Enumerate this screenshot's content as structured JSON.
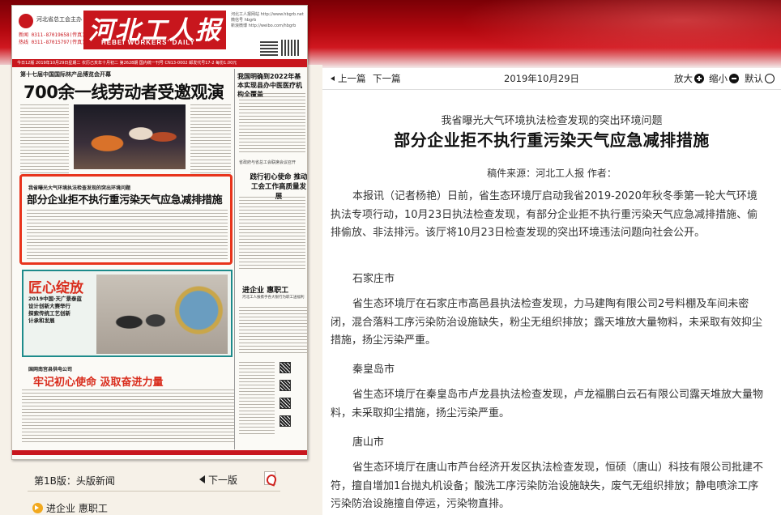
{
  "brand": {
    "accent": "#c8161d",
    "highlight": "#e8341c",
    "teal": "#1d8b8b"
  },
  "newspaper": {
    "sponsor": "河北省总工会主办",
    "tel": "新闻 0311-87019658(传真)\n热线 0311-87015797(传真)",
    "title": "河北工人报",
    "english_title": "HEBEI WORKERS' DAILY",
    "masthead_info": "河北工人报网站 http://www.hbgrb.net\n微信号 hbgrb\n新浪微博 http://weibo.com/hbgrb",
    "date_bar": "今日12版 2019年10月29日星期二 农历己亥年十月初二 第2628期 国内统一刊号 CN13-0002 邮发代号17-2 每份1.00元",
    "kicker1": "第十七届中国国际林产品博览会开幕",
    "head1": "700余一线劳动者受邀观演",
    "side_head1": "我国明确到2022年基本实现县办中医医疗机构全覆盖",
    "side_small": "省政府与省总工会联席会议召开",
    "side_head2": "践行初心使命 推动工会工作高质量发展",
    "highlight_kicker": "我省曝光大气环境执法检查发现的突出环境问题",
    "highlight_title": "部分企业拒不执行重污染天气应急减排措施",
    "ad_title": "匠心绽放",
    "ad_lines": [
      "2019中国·天广景泰蓝",
      "设计创新大赛举行",
      "探索传统工艺创新",
      "计承和发展"
    ],
    "right_box_title": "进企业 惠职工",
    "right_box_sub": "河北工人报携手各大银行为职工送福利",
    "kicker2": "国网南宫县供电公司",
    "head2": "牢记初心使命 汲取奋进力量"
  },
  "left_nav": {
    "version": "第1B版：头版新闻",
    "next_page": "下一版",
    "pdf_icon": "pdf-icon",
    "list_item": "进企业 惠职工"
  },
  "toolbar": {
    "prev": "上一篇",
    "next": "下一篇",
    "date": "2019年10月29日",
    "zoom_in": "放大",
    "zoom_out": "缩小",
    "default": "默认"
  },
  "article": {
    "kicker": "我省曝光大气环境执法检查发现的突出环境问题",
    "title": "部分企业拒不执行重污染天气应急减排措施",
    "meta": "稿件来源：河北工人报 作者：",
    "intro": "本报讯（记者杨艳）日前，省生态环境厅启动我省2019-2020年秋冬季第一轮大气环境执法专项行动，10月23日执法检查发现，有部分企业拒不执行重污染天气应急减排措施、偷排偷放、非法排污。该厅将10月23日检查发现的突出环境违法问题向社会公开。",
    "sections": [
      {
        "city": "石家庄市",
        "text": "省生态环境厅在石家庄市高邑县执法检查发现，力马建陶有限公司2号料棚及车间未密闭，混合落料工序污染防治设施缺失，粉尘无组织排放；露天堆放大量物料，未采取有效抑尘措施，扬尘污染严重。"
      },
      {
        "city": "秦皇岛市",
        "text": "省生态环境厅在秦皇岛市卢龙县执法检查发现，卢龙福鹏白云石有限公司露天堆放大量物料，未采取抑尘措施，扬尘污染严重。"
      },
      {
        "city": "唐山市",
        "text": "省生态环境厅在唐山市芦台经济开发区执法检查发现，恒硕（唐山）科技有限公司批建不符，擅自增加1台抛丸机设备；酸洗工序污染防治设施缺失，废气无组织排放；静电喷涂工序污染防治设施擅自停运，污染物直排。"
      }
    ]
  }
}
